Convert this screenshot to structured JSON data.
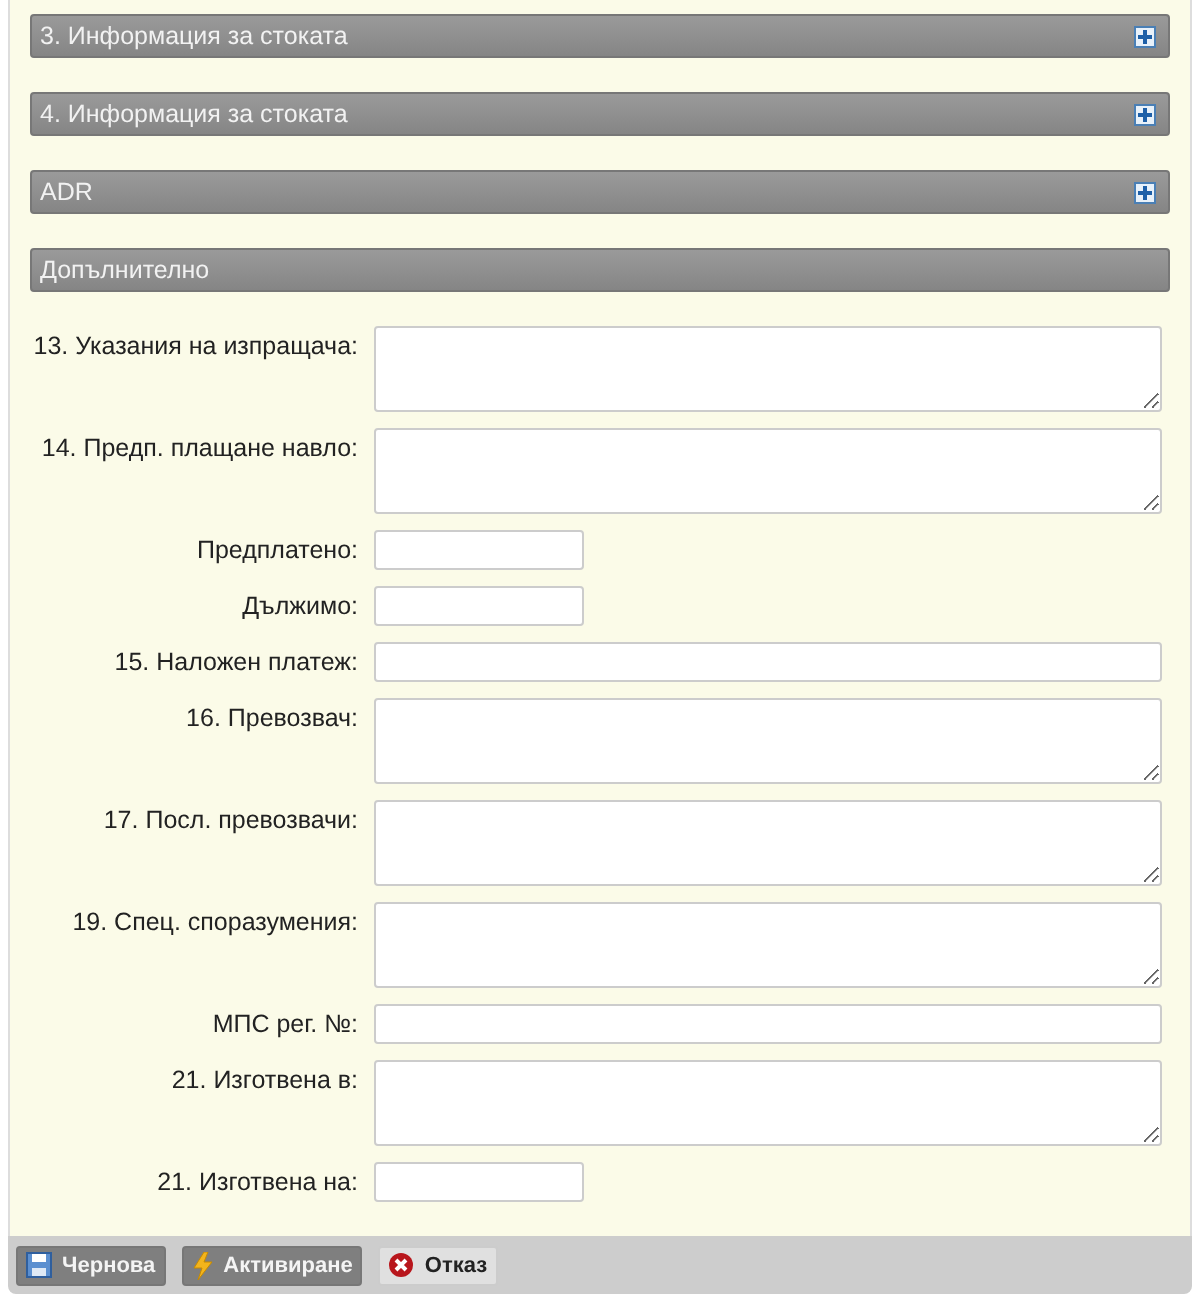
{
  "sections": [
    {
      "title": "3. Информация за стоката",
      "expanded": false
    },
    {
      "title": "4. Информация за стоката",
      "expanded": false
    },
    {
      "title": "ADR",
      "expanded": false
    },
    {
      "title": "Допълнително",
      "expanded": true
    }
  ],
  "fields": [
    {
      "label": "13. Указания на изпращача:",
      "kind": "textarea"
    },
    {
      "label": "14. Предп. плащане навло:",
      "kind": "textarea"
    },
    {
      "label": "Предплатено:",
      "kind": "short"
    },
    {
      "label": "Дължимо:",
      "kind": "short"
    },
    {
      "label": "15. Наложен платеж:",
      "kind": "long"
    },
    {
      "label": "16. Превозвач:",
      "kind": "textarea"
    },
    {
      "label": "17. Посл. превозвачи:",
      "kind": "textarea"
    },
    {
      "label": "19. Спец. споразумения:",
      "kind": "textarea"
    },
    {
      "label": "МПС рег. №:",
      "kind": "long"
    },
    {
      "label": "21. Изготвена в:",
      "kind": "textarea"
    },
    {
      "label": "21. Изготвена на:",
      "kind": "short"
    }
  ],
  "buttons": [
    {
      "label": "Чернова",
      "kind": "save"
    },
    {
      "label": "Активиране",
      "kind": "activate"
    },
    {
      "label": "Отказ",
      "kind": "cancel"
    }
  ]
}
